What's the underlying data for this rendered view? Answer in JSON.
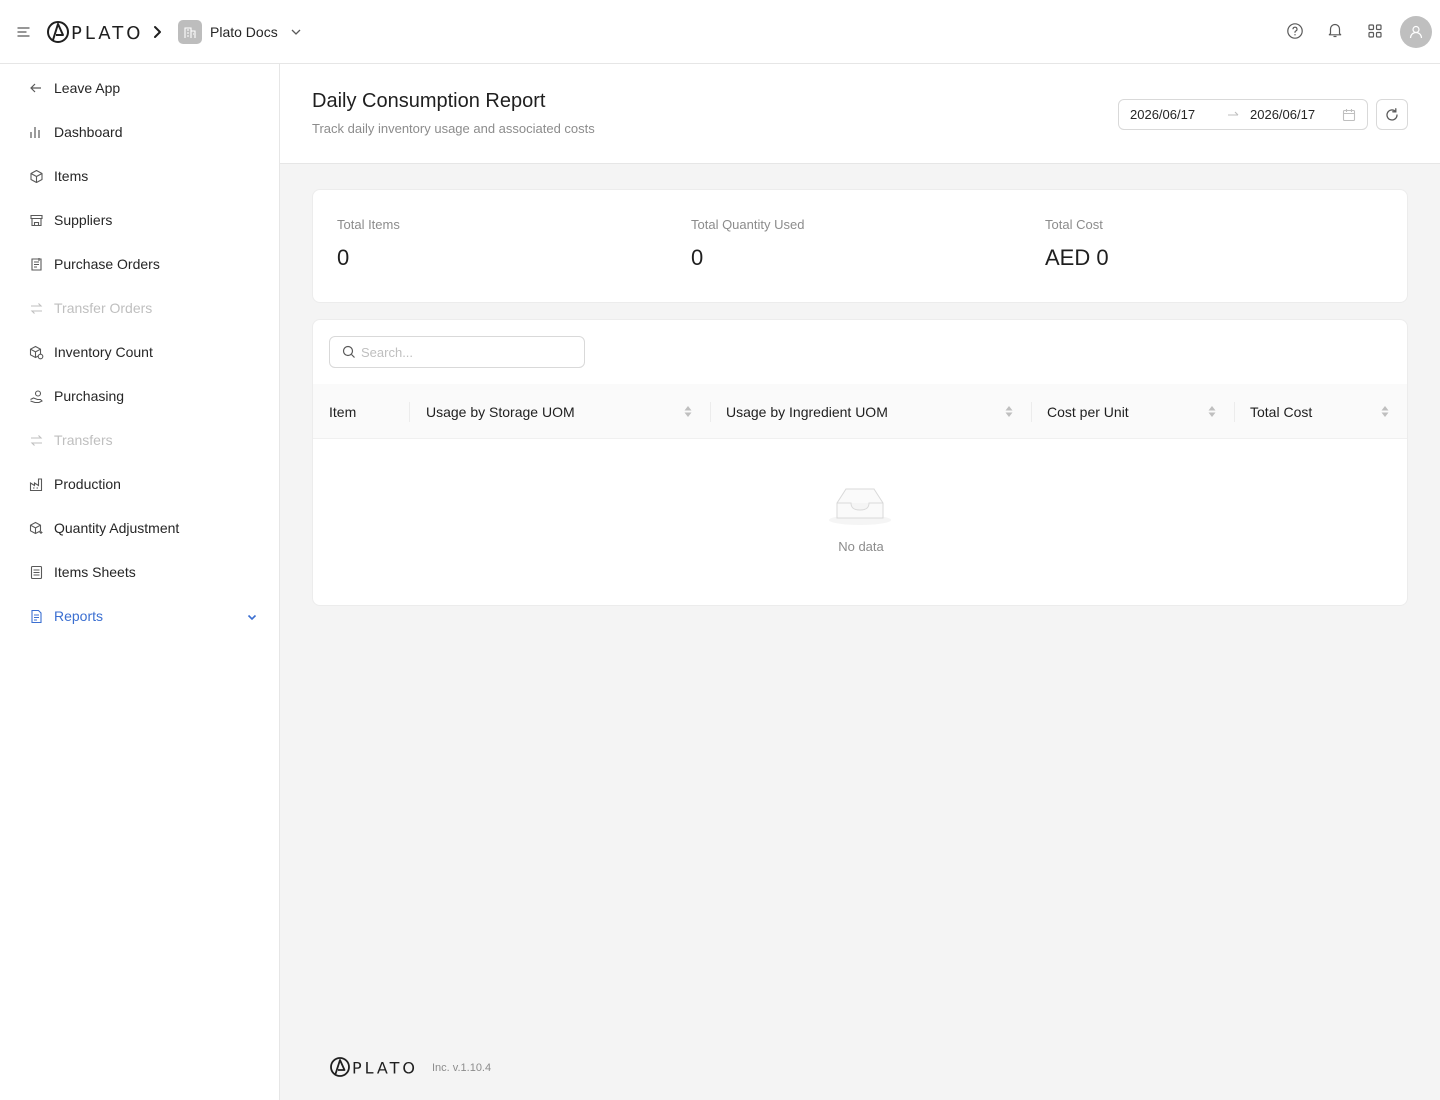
{
  "topbar": {
    "brand_name": "PLATO",
    "org_name": "Plato Docs",
    "icons": [
      "menu-icon",
      "chevron-right-icon",
      "building-icon",
      "chevron-down-icon",
      "help-icon",
      "bell-icon",
      "apps-grid-icon",
      "user-avatar-icon"
    ]
  },
  "sidebar": {
    "items": [
      {
        "label": "Leave App",
        "icon": "arrow-left-icon",
        "state": "normal"
      },
      {
        "label": "Dashboard",
        "icon": "bar-chart-icon",
        "state": "normal"
      },
      {
        "label": "Items",
        "icon": "box-icon",
        "state": "normal"
      },
      {
        "label": "Suppliers",
        "icon": "store-icon",
        "state": "normal"
      },
      {
        "label": "Purchase Orders",
        "icon": "clipboard-icon",
        "state": "normal"
      },
      {
        "label": "Transfer Orders",
        "icon": "swap-icon",
        "state": "disabled"
      },
      {
        "label": "Inventory Count",
        "icon": "count-box-icon",
        "state": "normal"
      },
      {
        "label": "Purchasing",
        "icon": "hand-coin-icon",
        "state": "normal"
      },
      {
        "label": "Transfers",
        "icon": "swap-icon",
        "state": "disabled"
      },
      {
        "label": "Production",
        "icon": "factory-icon",
        "state": "normal"
      },
      {
        "label": "Quantity Adjustment",
        "icon": "adjust-box-icon",
        "state": "normal"
      },
      {
        "label": "Items Sheets",
        "icon": "sheet-icon",
        "state": "normal"
      },
      {
        "label": "Reports",
        "icon": "report-icon",
        "state": "active",
        "expanded": true
      }
    ]
  },
  "header": {
    "title": "Daily Consumption Report",
    "subtitle": "Track daily inventory usage and associated costs",
    "date_start": "2026/06/17",
    "date_end": "2026/06/17"
  },
  "stats": [
    {
      "label": "Total Items",
      "value": "0"
    },
    {
      "label": "Total Quantity Used",
      "value": "0"
    },
    {
      "label": "Total Cost",
      "value": "AED 0"
    }
  ],
  "table": {
    "search_placeholder": "Search...",
    "columns": [
      {
        "label": "Item",
        "sortable": false
      },
      {
        "label": "Usage by Storage UOM",
        "sortable": true
      },
      {
        "label": "Usage by Ingredient UOM",
        "sortable": true
      },
      {
        "label": "Cost per Unit",
        "sortable": true
      },
      {
        "label": "Total Cost",
        "sortable": true
      }
    ],
    "rows": [],
    "empty_text": "No data"
  },
  "footer": {
    "brand_name": "PLATO",
    "version": "Inc. v.1.10.4"
  },
  "colors": {
    "accent": "#3b6fd1",
    "disabled": "#bfbfbf",
    "muted": "#8c8c8c",
    "background": "#f4f4f4"
  }
}
